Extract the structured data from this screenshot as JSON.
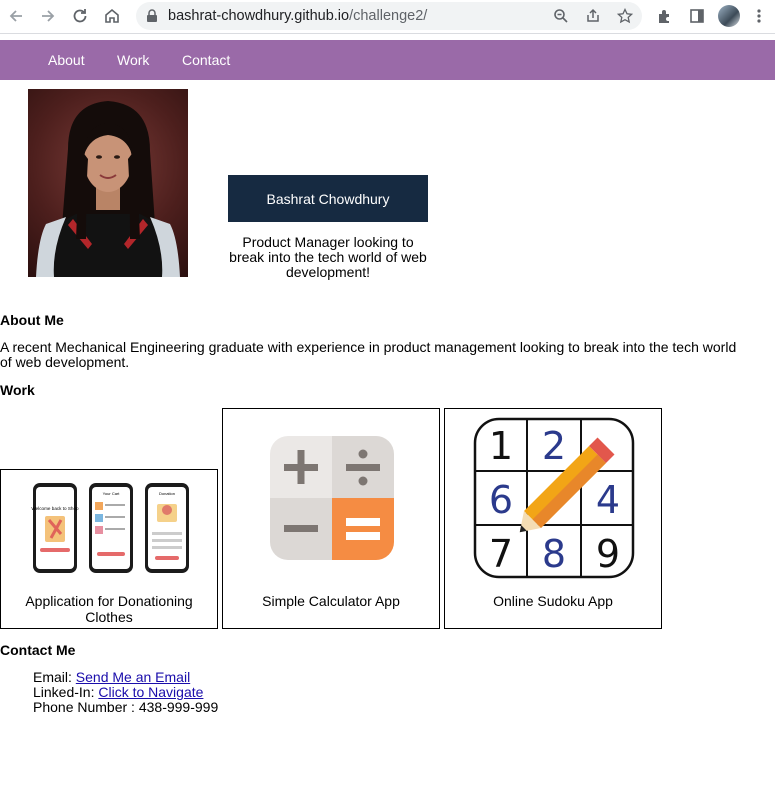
{
  "browser": {
    "url_host": "bashrat-chowdhury.github.io",
    "url_path": "/challenge2/"
  },
  "nav": {
    "items": [
      "About",
      "Work",
      "Contact"
    ]
  },
  "hero": {
    "name": "Bashrat Chowdhury",
    "tagline": "Product Manager looking to break into the tech world of web development!"
  },
  "about": {
    "heading": "About Me",
    "text": "A recent Mechanical Engineering graduate with experience in product management looking to break into the tech world of web development."
  },
  "work": {
    "heading": "Work",
    "projects": [
      {
        "title": "Application for Donationing Clothes"
      },
      {
        "title": "Simple Calculator App"
      },
      {
        "title": "Online Sudoku App"
      }
    ],
    "sudoku_digits": [
      "1",
      "2",
      "",
      "6",
      "",
      "4",
      "7",
      "8",
      "9"
    ],
    "phone_screen_texts": [
      "Welcome back to Shop",
      "Your Cart",
      "Donation"
    ]
  },
  "contact": {
    "heading": "Contact Me",
    "email_label": "Email:",
    "email_link": "Send Me an Email",
    "linkedin_label": "Linked-In:",
    "linkedin_link": "Click to Navigate",
    "phone_line": "Phone Number : 438-999-999"
  },
  "colors": {
    "nav_bg": "#9a6aa8",
    "name_box_bg": "#162a41",
    "calc_orange": "#f58c43",
    "sudoku_blue": "#2b3a8c"
  }
}
